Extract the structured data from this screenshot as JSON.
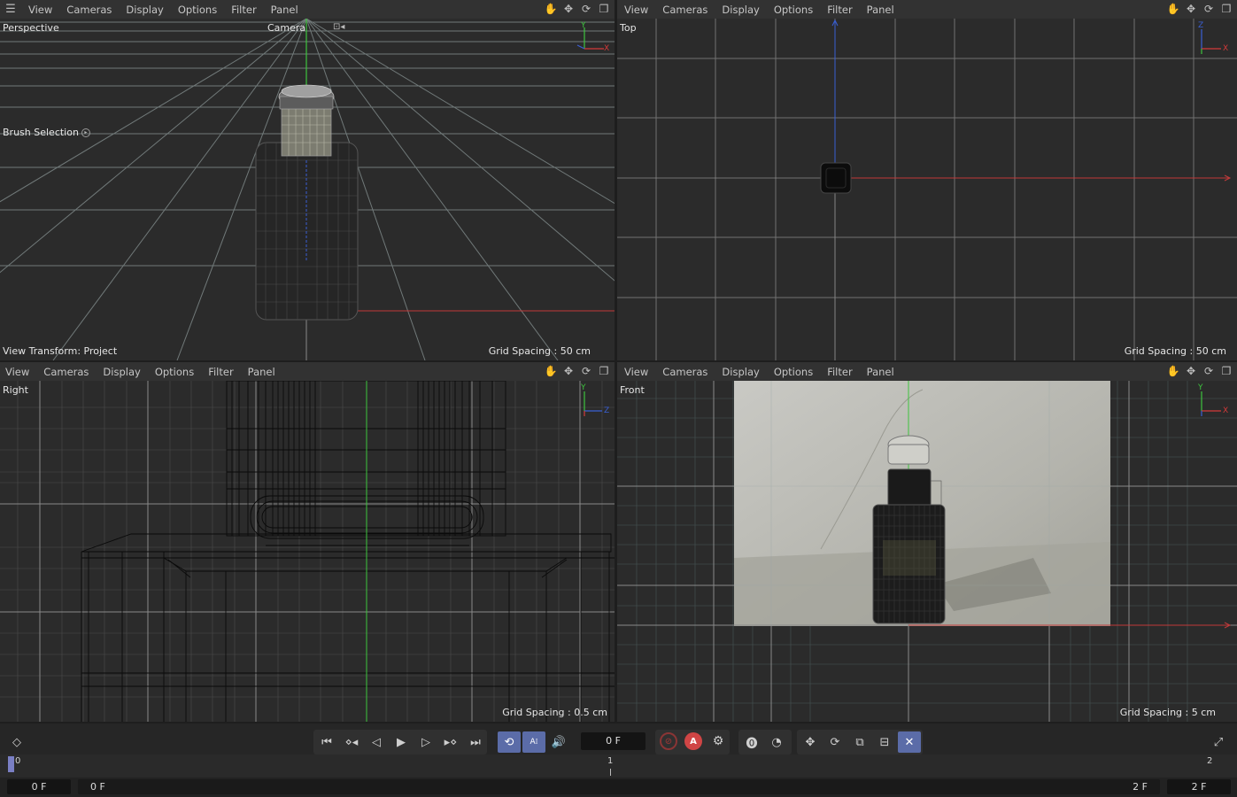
{
  "menu": [
    "View",
    "Cameras",
    "Display",
    "Options",
    "Filter",
    "Panel"
  ],
  "viewports": {
    "perspective": {
      "name": "Perspective",
      "camera": "Camera",
      "brush": "Brush Selection",
      "transform": "View Transform: Project",
      "grid": "Grid Spacing : 50 cm"
    },
    "top": {
      "name": "Top",
      "grid": "Grid Spacing : 50 cm"
    },
    "right": {
      "name": "Right",
      "grid": "Grid Spacing : 0.5 cm"
    },
    "front": {
      "name": "Front",
      "grid": "Grid Spacing : 5 cm"
    }
  },
  "axes": {
    "x": "X",
    "y": "Y",
    "z": "Z"
  },
  "timeline": {
    "current_frame": "0 F",
    "ruler_ticks": [
      "0",
      "1",
      "2"
    ],
    "start_field": "0 F",
    "range_start": "0 F",
    "range_end": "2 F",
    "end_field": "2 F",
    "autokey_label": "A"
  },
  "colors": {
    "axis_x": "#d33a3a",
    "axis_y": "#3ec43e",
    "axis_z": "#3a5fd3",
    "accent": "#5b6ca8"
  }
}
